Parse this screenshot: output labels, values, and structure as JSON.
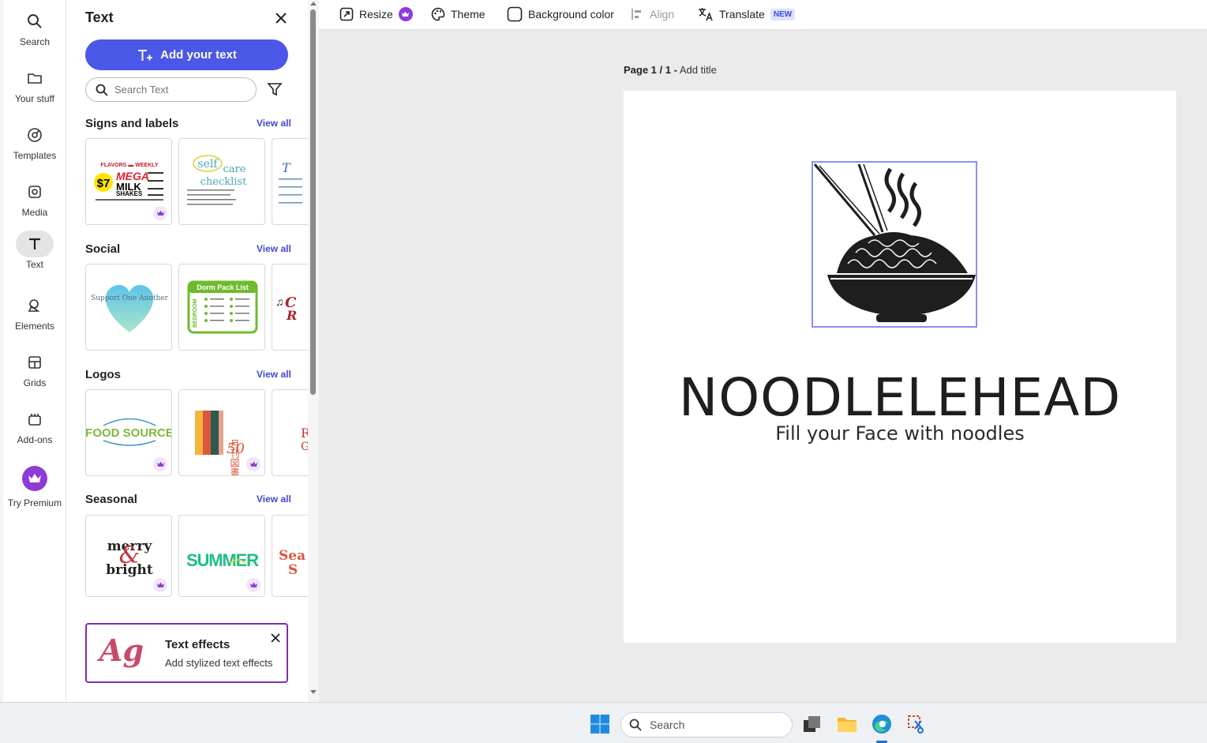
{
  "rail": {
    "items": [
      {
        "label": "Search",
        "icon": "search-icon"
      },
      {
        "label": "Your stuff",
        "icon": "folder-icon"
      },
      {
        "label": "Templates",
        "icon": "templates-icon"
      },
      {
        "label": "Media",
        "icon": "media-icon"
      },
      {
        "label": "Text",
        "icon": "text-icon"
      },
      {
        "label": "Elements",
        "icon": "elements-icon"
      },
      {
        "label": "Grids",
        "icon": "grids-icon"
      },
      {
        "label": "Add-ons",
        "icon": "add-ons-icon"
      },
      {
        "label": "Try Premium",
        "icon": "crown-icon"
      }
    ]
  },
  "panel": {
    "title": "Text",
    "add_button": "Add your text",
    "search_placeholder": "Search Text",
    "view_all": "View all",
    "sections": [
      {
        "title": "Signs and labels"
      },
      {
        "title": "Social"
      },
      {
        "title": "Logos"
      },
      {
        "title": "Seasonal"
      }
    ],
    "thumbs": {
      "mega_flavors": "FLAVORS",
      "mega_weekly": "WEEKLY",
      "mega_price": "$7",
      "mega_l1": "MEGA",
      "mega_l2": "MILK",
      "mega_l3": "SHAKES",
      "selfcare_l1": "self",
      "selfcare_l2": "care",
      "selfcare_l3": "checklist",
      "heart_text": "Support One Another",
      "dorm_title": "Dorm Pack List",
      "dorm_side": "BEDROOM",
      "food_source": "FOOD SOURCE",
      "jp_text": "月刊図書リスト",
      "jp_num": "50",
      "merry_l1": "merry",
      "merry_l2": "bright",
      "summer": "SUMMER"
    },
    "effects": {
      "icon_text": "Ag",
      "title": "Text effects",
      "subtitle": "Add stylized text effects"
    }
  },
  "toolbar": {
    "resize": "Resize",
    "theme": "Theme",
    "background_color": "Background color",
    "align": "Align",
    "translate": "Translate",
    "new_badge": "NEW"
  },
  "canvas": {
    "page_label": "Page 1 / 1 -",
    "add_title": "Add title",
    "brand": "NOODLELEHEAD",
    "tagline": "Fill your Face with noodles"
  },
  "taskbar": {
    "search": "Search"
  },
  "colors": {
    "accent": "#4b57e6",
    "premium": "#8f3bd6",
    "effects_border": "#7b2fb5"
  }
}
